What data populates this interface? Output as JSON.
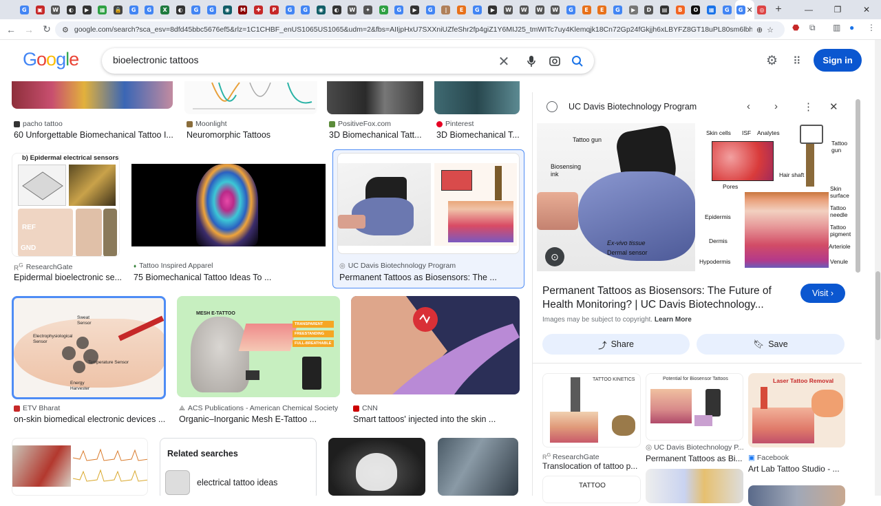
{
  "browser": {
    "tabs": [
      {
        "glyph": "G",
        "color": "#4285f4"
      },
      {
        "glyph": "▣",
        "color": "#c62828"
      },
      {
        "glyph": "W",
        "color": "#555"
      },
      {
        "glyph": "◐",
        "color": "#333"
      },
      {
        "glyph": "▶",
        "color": "#333"
      },
      {
        "glyph": "▦",
        "color": "#2ea043"
      },
      {
        "glyph": "🔒",
        "color": "#444"
      },
      {
        "glyph": "G",
        "color": "#4285f4"
      },
      {
        "glyph": "G",
        "color": "#4285f4"
      },
      {
        "glyph": "X",
        "color": "#1e7a3e"
      },
      {
        "glyph": "◐",
        "color": "#333"
      },
      {
        "glyph": "G",
        "color": "#4285f4"
      },
      {
        "glyph": "G",
        "color": "#4285f4"
      },
      {
        "glyph": "◉",
        "color": "#115e67"
      },
      {
        "glyph": "M",
        "color": "#8b0000"
      },
      {
        "glyph": "✚",
        "color": "#c62828"
      },
      {
        "glyph": "P",
        "color": "#c62828"
      },
      {
        "glyph": "G",
        "color": "#4285f4"
      },
      {
        "glyph": "G",
        "color": "#4285f4"
      },
      {
        "glyph": "◉",
        "color": "#115e67"
      },
      {
        "glyph": "◐",
        "color": "#333"
      },
      {
        "glyph": "W",
        "color": "#555"
      },
      {
        "glyph": "✦",
        "color": "#555"
      },
      {
        "glyph": "✿",
        "color": "#2ea043"
      },
      {
        "glyph": "G",
        "color": "#4285f4"
      },
      {
        "glyph": "▶",
        "color": "#333"
      },
      {
        "glyph": "G",
        "color": "#4285f4"
      },
      {
        "glyph": "|",
        "color": "#b0805a"
      },
      {
        "glyph": "E",
        "color": "#e8711a"
      },
      {
        "glyph": "G",
        "color": "#4285f4"
      },
      {
        "glyph": "▶",
        "color": "#333"
      },
      {
        "glyph": "W",
        "color": "#555"
      },
      {
        "glyph": "W",
        "color": "#555"
      },
      {
        "glyph": "W",
        "color": "#555"
      },
      {
        "glyph": "W",
        "color": "#555"
      },
      {
        "glyph": "G",
        "color": "#4285f4"
      },
      {
        "glyph": "E",
        "color": "#e8711a"
      },
      {
        "glyph": "E",
        "color": "#e8711a"
      },
      {
        "glyph": "G",
        "color": "#4285f4"
      },
      {
        "glyph": "▶",
        "color": "#777"
      },
      {
        "glyph": "D",
        "color": "#555"
      },
      {
        "glyph": "▤",
        "color": "#333"
      },
      {
        "glyph": "B",
        "color": "#f26522"
      },
      {
        "glyph": "O",
        "color": "#111"
      },
      {
        "glyph": "▦",
        "color": "#1a73e8"
      },
      {
        "glyph": "G",
        "color": "#4285f4"
      },
      {
        "glyph": "◎",
        "color": "#d44"
      }
    ],
    "active_tab_glyph": "G",
    "url": "google.com/search?sca_esv=8dfd45bbc5676ef5&rlz=1C1CHBF_enUS1065US1065&udm=2&fbs=AIIjpHxU7SXXniUZfeShr2fp4giZ1Y6MIJ25_tmWITc7uy4Klemqjk18Cn72Gp24fGkjjh6xLBYFZ8GT18uPL80sm6lbhfoHXnZSnR1I7vykvC7VeP6xIFou...",
    "window_controls": [
      "—",
      "❐",
      "✕"
    ]
  },
  "search": {
    "logo": "Google",
    "query": "bioelectronic tattoos"
  },
  "header": {
    "signin_label": "Sign in"
  },
  "results": [
    {
      "source": "pacho tattoo",
      "title": "60 Unforgettable Biomechanical Tattoo I..."
    },
    {
      "source": "Moonlight",
      "title": "Neuromorphic Tattoos"
    },
    {
      "source": "PositiveFox.com",
      "title": "3D Biomechanical Tatt..."
    },
    {
      "source": "Pinterest",
      "title": "3D Biomechanical T..."
    },
    {
      "source": "ResearchGate",
      "title": "Epidermal bioelectronic se...",
      "caption": "b) Epidermal electrical sensors"
    },
    {
      "source": "Tattoo Inspired Apparel",
      "title": "75 Biomechanical Tattoo Ideas To ..."
    },
    {
      "source": "UC Davis Biotechnology Program",
      "title": "Permanent Tattoos as Biosensors: The ..."
    },
    {
      "source": "ETV Bharat",
      "title": "on-skin biomedical electronic devices ..."
    },
    {
      "source": "ACS Publications - American Chemical Society",
      "title": "Organic–Inorganic Mesh E-Tattoo ..."
    },
    {
      "source": "CNN",
      "title": "Smart tattoos' injected into the skin ..."
    }
  ],
  "thumb_labels": {
    "sweat": "Sweat Sensor",
    "electro": "Electrophysiological Sensor",
    "temp": "Temperature Sensor",
    "energy": "Energy Harvester",
    "mesh": "MESH E-TATTOO",
    "transparent": "TRANSPARENT",
    "freestanding": "FREESTANDING",
    "breathable": "FULL-BREATHABLE",
    "ref": "REF",
    "gnd": "GND"
  },
  "related_searches": {
    "heading": "Related searches",
    "items": [
      "electrical tattoo ideas"
    ]
  },
  "panel": {
    "site": "UC Davis Biotechnology Program",
    "title": "Permanent Tattoos as Biosensors: The Future of Health Monitoring? | UC Davis Biotechnology...",
    "visit_label": "Visit",
    "copyright": "Images may be subject to copyright.",
    "learn_more": "Learn More",
    "share_label": "Share",
    "save_label": "Save",
    "diagram_labels": {
      "tattoo_gun_left": "Tattoo gun",
      "biosensing_ink": "Biosensing ink",
      "ex_vivo": "Ex-vivo tissue",
      "dermal_sensor": "Dermal sensor",
      "skin_cells": "Skin cells",
      "isf": "ISF",
      "analytes": "Analytes",
      "tattoo_gun_right": "Tattoo gun",
      "hair_shaft": "Hair shaft",
      "pores": "Pores",
      "skin_surface": "Skin surface",
      "tattoo_needle": "Tattoo needle",
      "tattoo_pigment": "Tattoo pigment",
      "epidermis": "Epidermis",
      "dermis": "Dermis",
      "hypodermis": "Hypodermis",
      "arteriole": "Arteriole",
      "venule": "Venule"
    },
    "related": [
      {
        "source": "ResearchGate",
        "title": "Translocation of tattoo p...",
        "caption": "TATTOO KINETICS"
      },
      {
        "source": "UC Davis Biotechnology P...",
        "title": "Permanent Tattoos as Bi...",
        "caption": "Potential for Biosensor Tattoos"
      },
      {
        "source": "Facebook",
        "title": "Art Lab Tattoo Studio - ...",
        "caption": "Laser Tattoo Removal"
      }
    ],
    "tattoo_tile": "TATTOO"
  }
}
